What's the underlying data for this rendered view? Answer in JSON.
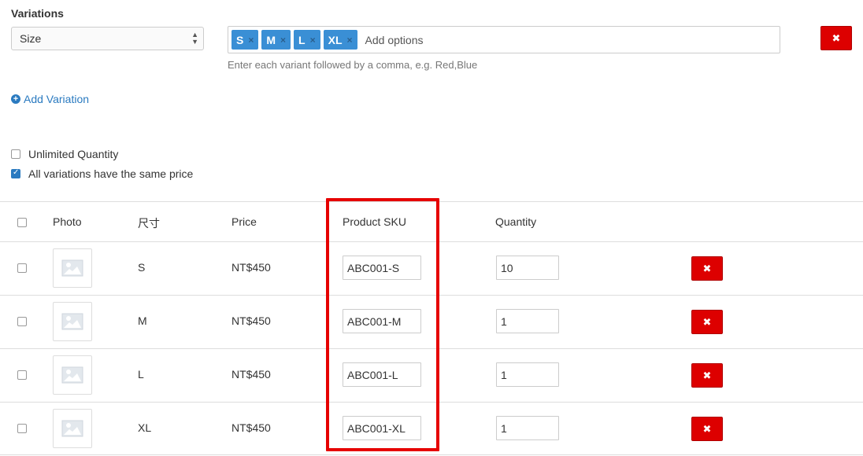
{
  "variations": {
    "title": "Variations",
    "select_value": "Size",
    "tags": [
      "S",
      "M",
      "L",
      "XL"
    ],
    "tag_remove_glyph": "×",
    "placeholder": "Add options",
    "hint": "Enter each variant followed by a comma, e.g. Red,Blue",
    "delete_glyph": "✖"
  },
  "add_variation": {
    "label": "Add Variation",
    "icon": "plus-circle-icon"
  },
  "options": {
    "unlimited_quantity": {
      "label": "Unlimited Quantity",
      "checked": false
    },
    "same_price": {
      "label": "All variations have the same price",
      "checked": true
    }
  },
  "table": {
    "headers": {
      "photo": "Photo",
      "size": "尺寸",
      "price": "Price",
      "sku": "Product SKU",
      "quantity": "Quantity"
    },
    "rows": [
      {
        "size": "S",
        "price": "NT$450",
        "sku": "ABC001-S",
        "quantity": "10"
      },
      {
        "size": "M",
        "price": "NT$450",
        "sku": "ABC001-M",
        "quantity": "1"
      },
      {
        "size": "L",
        "price": "NT$450",
        "sku": "ABC001-L",
        "quantity": "1"
      },
      {
        "size": "XL",
        "price": "NT$450",
        "sku": "ABC001-XL",
        "quantity": "1"
      }
    ],
    "delete_glyph": "✖"
  },
  "colors": {
    "accent": "#3a8fd5",
    "link": "#2a7ac0",
    "danger": "#dd0000",
    "highlight": "#e60000"
  }
}
